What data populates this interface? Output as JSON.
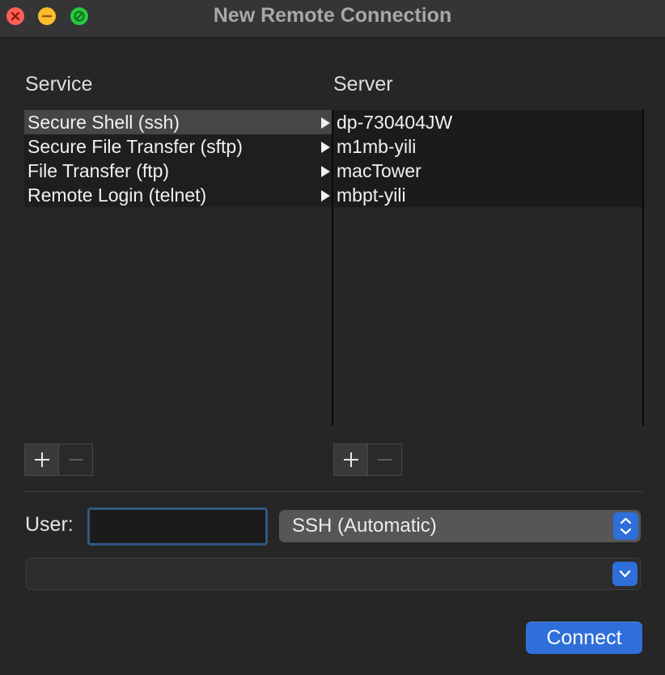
{
  "window": {
    "title": "New Remote Connection"
  },
  "service": {
    "heading": "Service",
    "items": [
      {
        "label": "Secure Shell (ssh)",
        "selected": true
      },
      {
        "label": "Secure File Transfer (sftp)",
        "selected": false
      },
      {
        "label": "File Transfer (ftp)",
        "selected": false
      },
      {
        "label": "Remote Login (telnet)",
        "selected": false
      }
    ]
  },
  "server": {
    "heading": "Server",
    "items": [
      {
        "label": "dp-730404JW"
      },
      {
        "label": "m1mb-yili"
      },
      {
        "label": "macTower"
      },
      {
        "label": "mbpt-yili"
      }
    ]
  },
  "icons": {
    "plus": "plus-icon",
    "minus": "minus-icon",
    "disclosure": "disclosure-arrow-icon",
    "stepper": "up-down-chevron-icon",
    "dropdown": "chevron-down-icon"
  },
  "form": {
    "user_label": "User:",
    "user_value": "",
    "protocol_selected": "SSH (Automatic)",
    "command_value": ""
  },
  "actions": {
    "connect_label": "Connect"
  },
  "colors": {
    "accent": "#2f6fd9",
    "close": "#fe5f57",
    "minimize": "#febc2e",
    "maximize": "#28c840"
  }
}
